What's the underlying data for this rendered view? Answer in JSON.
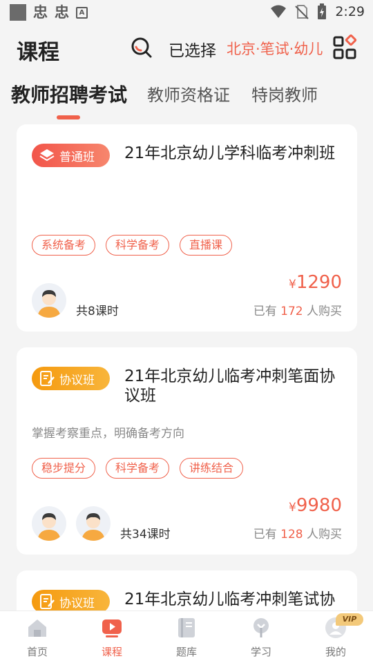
{
  "status_bar": {
    "time": "2:29"
  },
  "header": {
    "title": "课程",
    "selected_label": "已选择",
    "selected_value": "北京·笔试·幼儿"
  },
  "tabs": [
    {
      "label": "教师招聘考试",
      "active": true
    },
    {
      "label": "教师资格证",
      "active": false
    },
    {
      "label": "特岗教师",
      "active": false
    }
  ],
  "courses": [
    {
      "badge": "普通班",
      "badge_color": "#f2554a",
      "title": "21年北京幼儿学科临考冲刺班",
      "description": "",
      "tags": [
        "系统备考",
        "科学备考",
        "直播课"
      ],
      "lessons": "共8课时",
      "currency": "¥",
      "price": "1290",
      "buyers_prefix": "已有",
      "buyers_count": "172",
      "buyers_suffix": "人购买"
    },
    {
      "badge": "协议班",
      "badge_color": "#f59a0f",
      "title": "21年北京幼儿临考冲刺笔面协议班",
      "description": "掌握考察重点，明确备考方向",
      "tags": [
        "稳步提分",
        "科学备考",
        "讲练结合"
      ],
      "lessons": "共34课时",
      "currency": "¥",
      "price": "9980",
      "buyers_prefix": "已有",
      "buyers_count": "128",
      "buyers_suffix": "人购买"
    },
    {
      "badge": "协议班",
      "badge_color": "#f59a0f",
      "title": "21年北京幼儿临考冲刺笔试协"
    }
  ],
  "bottom_nav": [
    {
      "label": "首页",
      "icon": "home-icon",
      "active": false
    },
    {
      "label": "课程",
      "icon": "play-icon",
      "active": true
    },
    {
      "label": "题库",
      "icon": "book-icon",
      "active": false
    },
    {
      "label": "学习",
      "icon": "lightbulb-icon",
      "active": false
    },
    {
      "label": "我的",
      "icon": "profile-icon",
      "active": false
    }
  ],
  "vip_badge": "VIP",
  "colors": {
    "accent": "#f0614b",
    "orange": "#f59a0f",
    "background": "#f4f4f4"
  }
}
